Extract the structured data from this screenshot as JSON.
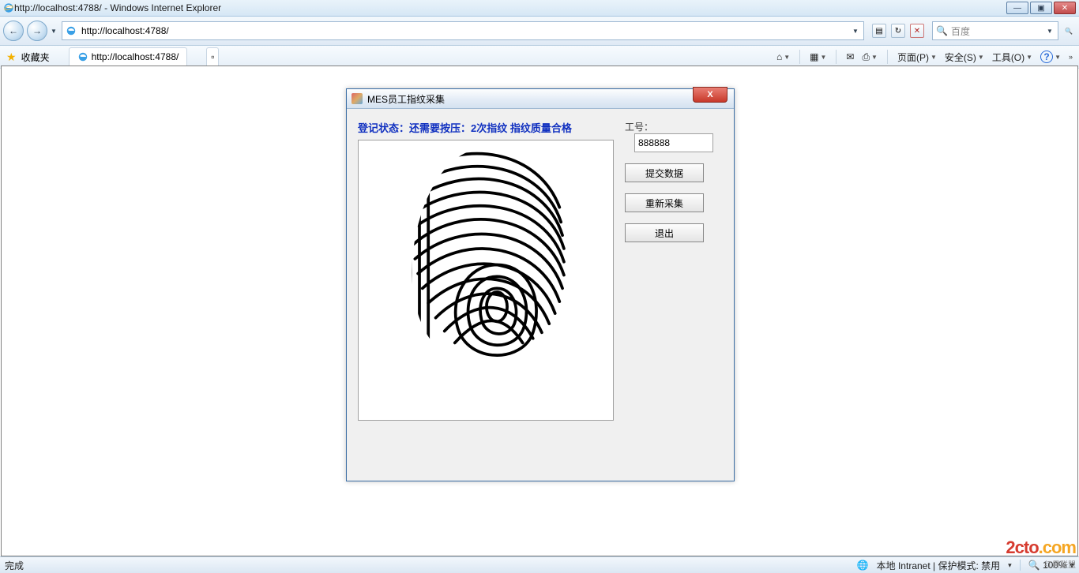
{
  "window": {
    "title": "http://localhost:4788/ - Windows Internet Explorer",
    "min": "—",
    "max": "▣",
    "close": "✕"
  },
  "nav": {
    "back": "←",
    "fwd": "→",
    "url": "http://localhost:4788/",
    "refresh": "↻",
    "stop": "✕",
    "search_placeholder": "百度",
    "search_icon": "🔍"
  },
  "fav": {
    "label": "收藏夹",
    "tab_title": "http://localhost:4788/"
  },
  "cmdbar": {
    "home": "⌂",
    "rss": "▦",
    "mail": "✉",
    "print": "⎙",
    "page": "页面(P)",
    "safety": "安全(S)",
    "tools": "工具(O)",
    "help": "?"
  },
  "dialog": {
    "title": "MES员工指纹采集",
    "close": "X",
    "status": "登记状态：还需要按压：2次指纹 指纹质量合格",
    "emp_label": "工号：",
    "emp_value": "888888",
    "btn_submit": "提交数据",
    "btn_retry": "重新采集",
    "btn_exit": "退出"
  },
  "status": {
    "left": "完成",
    "zone": "本地 Intranet | 保护模式: 禁用",
    "zoom": "100%"
  },
  "watermark": {
    "main1": "2cto",
    "main2": ".com",
    "sub": "红黑联盟"
  }
}
